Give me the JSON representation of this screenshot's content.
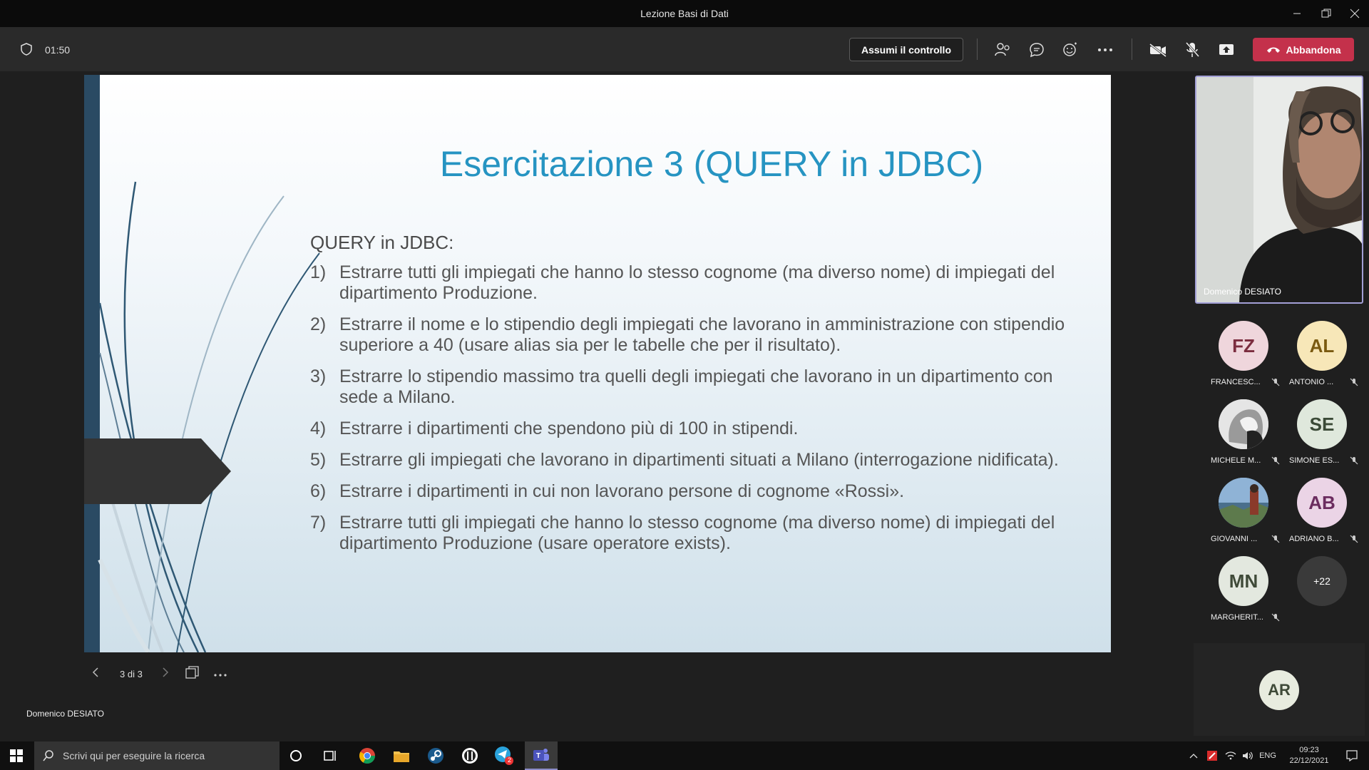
{
  "window": {
    "title": "Lezione Basi di Dati"
  },
  "toolbar": {
    "timer": "01:50",
    "take_control_label": "Assumi il controllo",
    "leave_label": "Abbandona",
    "leave_color": "#c4314b"
  },
  "slide": {
    "title": "Esercitazione 3 (QUERY in JDBC)",
    "subtitle": "QUERY in JDBC:",
    "items": [
      {
        "num": "1)",
        "text": "Estrarre tutti gli impiegati che hanno lo stesso cognome (ma diverso nome) di impiegati del dipartimento Produzione."
      },
      {
        "num": "2)",
        "text": "Estrarre il nome e lo stipendio degli impiegati che lavorano in amministrazione con stipendio superiore a 40 (usare alias sia per le tabelle che per il risultato)."
      },
      {
        "num": "3)",
        "text": "Estrarre lo stipendio massimo tra quelli degli impiegati che lavorano in un dipartimento con sede a Milano."
      },
      {
        "num": "4)",
        "text": "Estrarre i dipartimenti che spendono più di 100 in stipendi."
      },
      {
        "num": "5)",
        "text": "Estrarre gli impiegati che lavorano in dipartimenti situati a Milano (interrogazione nidificata)."
      },
      {
        "num": "6)",
        "text": "Estrarre i dipartimenti in cui non lavorano persone di cognome «Rossi»."
      },
      {
        "num": "7)",
        "text": "Estrarre tutti gli impiegati che hanno lo stesso cognome (ma diverso nome) di impiegati del dipartimento Produzione (usare operatore exists)."
      }
    ],
    "title_color": "#2694c2",
    "accent_color": "#2a4a63"
  },
  "slide_nav": {
    "page_label": "3 di 3"
  },
  "presenter": {
    "name": "Domenico DESIATO"
  },
  "video": {
    "name": "Domenico DESIATO"
  },
  "participants": [
    {
      "initials": "FZ",
      "name": "FRANCESC...",
      "color": "#efd6dc"
    },
    {
      "initials": "AL",
      "name": "ANTONIO ...",
      "color": "#f7e7b8"
    },
    {
      "initials": "",
      "name": "MICHELE M...",
      "color": "#cfcfcf"
    },
    {
      "initials": "SE",
      "name": "SIMONE ES...",
      "color": "#dfe8dc"
    },
    {
      "initials": "",
      "name": "GIOVANNI ...",
      "color": "#7ea3c4"
    },
    {
      "initials": "AB",
      "name": "ADRIANO B...",
      "color": "#ebd4e6"
    },
    {
      "initials": "MN",
      "name": "MARGHERIT...",
      "color": "#e3e8df"
    }
  ],
  "overflow": {
    "label": "+22"
  },
  "ar_avatar": {
    "initials": "AR"
  },
  "taskbar": {
    "search_placeholder": "Scrivi qui per eseguire la ricerca",
    "language": "ENG",
    "time": "09:23",
    "date": "22/12/2021",
    "telegram_badge": "2"
  }
}
